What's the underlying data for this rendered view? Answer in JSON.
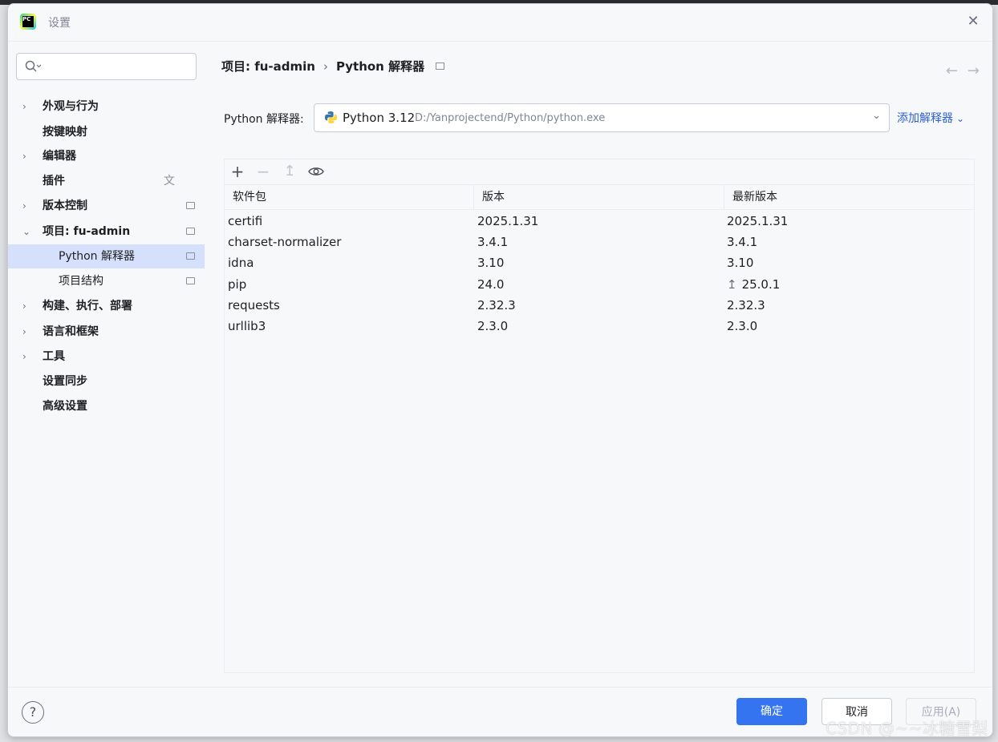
{
  "dialog": {
    "title": "设置",
    "close_symbol": "✕"
  },
  "search": {
    "placeholder": ""
  },
  "sidebar": {
    "items": [
      {
        "label": "外观与行为",
        "chevron": "›",
        "level": 0
      },
      {
        "label": "按键映射",
        "chevron": "",
        "level": 0
      },
      {
        "label": "编辑器",
        "chevron": "›",
        "level": 0
      },
      {
        "label": "插件",
        "chevron": "",
        "level": 0,
        "icon": "translate-icon"
      },
      {
        "label": "版本控制",
        "chevron": "›",
        "level": 0,
        "icon": "project-badge-icon"
      },
      {
        "label": "项目: fu-admin",
        "chevron": "⌄",
        "level": 0,
        "icon": "project-badge-icon"
      },
      {
        "label": "Python 解释器",
        "chevron": "",
        "level": 1,
        "selected": true,
        "icon": "project-badge-icon"
      },
      {
        "label": "项目结构",
        "chevron": "",
        "level": 1,
        "icon": "project-badge-icon"
      },
      {
        "label": "构建、执行、部署",
        "chevron": "›",
        "level": 0
      },
      {
        "label": "语言和框架",
        "chevron": "›",
        "level": 0
      },
      {
        "label": "工具",
        "chevron": "›",
        "level": 0
      },
      {
        "label": "设置同步",
        "chevron": "",
        "level": 0
      },
      {
        "label": "高级设置",
        "chevron": "",
        "level": 0
      }
    ]
  },
  "breadcrumb": {
    "project": "项目: fu-admin",
    "separator": "›",
    "page": "Python 解释器"
  },
  "nav": {
    "back": "←",
    "forward": "→"
  },
  "interpreter": {
    "label": "Python 解释器:",
    "name": "Python 3.12",
    "path": "D:/Yanprojectend/Python/python.exe",
    "add_label": "添加解释器",
    "chevron": "⌄"
  },
  "toolbar": {
    "add": "+",
    "remove": "−",
    "upgrade": "↥"
  },
  "table": {
    "columns": [
      "软件包",
      "版本",
      "最新版本"
    ],
    "rows": [
      {
        "name": "certifi",
        "version": "2025.1.31",
        "latest": "2025.1.31",
        "upgrade": false
      },
      {
        "name": "charset-normalizer",
        "version": "3.4.1",
        "latest": "3.4.1",
        "upgrade": false
      },
      {
        "name": "idna",
        "version": "3.10",
        "latest": "3.10",
        "upgrade": false
      },
      {
        "name": "pip",
        "version": "24.0",
        "latest": "25.0.1",
        "upgrade": true
      },
      {
        "name": "requests",
        "version": "2.32.3",
        "latest": "2.32.3",
        "upgrade": false
      },
      {
        "name": "urllib3",
        "version": "2.3.0",
        "latest": "2.3.0",
        "upgrade": false
      }
    ]
  },
  "footer": {
    "help": "?",
    "ok": "确定",
    "cancel": "取消",
    "apply": "应用(A)"
  },
  "watermark": "CSDN @~~冰糖雪梨",
  "colors": {
    "accent": "#3574f0",
    "selected": "#d5e1fc",
    "link": "#2c5fd2"
  }
}
